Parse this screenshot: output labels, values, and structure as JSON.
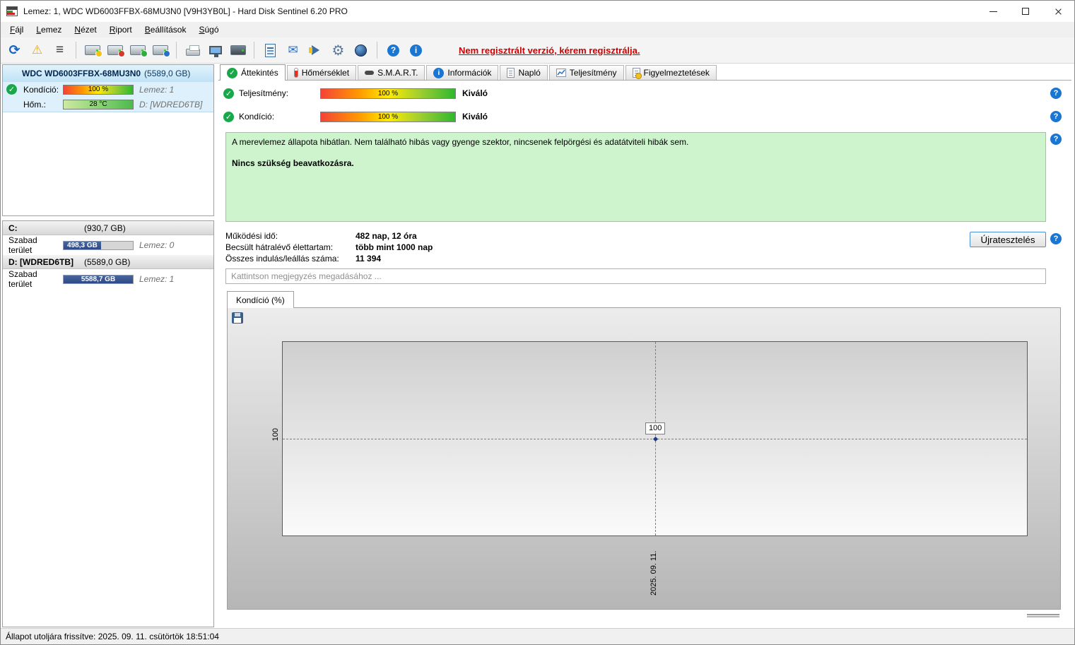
{
  "window": {
    "title": "Lemez: 1, WDC WD6003FFBX-68MU3N0 [V9H3YB0L]  -  Hard Disk Sentinel 6.20 PRO"
  },
  "menu": {
    "items": [
      {
        "label": "Fájl"
      },
      {
        "label": "Lemez"
      },
      {
        "label": "Nézet"
      },
      {
        "label": "Riport"
      },
      {
        "label": "Beállítások"
      },
      {
        "label": "Súgó"
      }
    ]
  },
  "toolbar": {
    "register_notice": "Nem regisztrált verzió, kérem regisztrálja.",
    "glyphs": {
      "refresh": "⟳",
      "warning": "⚠",
      "list": "≡",
      "envelope": "✉",
      "gear": "⚙",
      "help": "?",
      "info": "i"
    }
  },
  "sidebar": {
    "disk": {
      "name": "WDC WD6003FFBX-68MU3N0",
      "size": "(5589,0 GB)",
      "condition_label": "Kondíció:",
      "condition_value": "100 %",
      "disk_index": "Lemez: 1",
      "temp_label": "Hőm.:",
      "temp_value": "28 °C",
      "volume": "D: [WDRED6TB]"
    },
    "partitions": [
      {
        "name": "C:",
        "size": "(930,7 GB)",
        "free_label": "Szabad terület",
        "free_value": "498,3 GB",
        "free_percent": 54,
        "disk_index": "Lemez: 0"
      },
      {
        "name": "D: [WDRED6TB]",
        "size": "(5589,0 GB)",
        "free_label": "Szabad terület",
        "free_value": "5588,7 GB",
        "free_percent": 100,
        "disk_index": "Lemez: 1"
      }
    ]
  },
  "tabs": {
    "items": [
      {
        "label": "Áttekintés"
      },
      {
        "label": "Hőmérséklet"
      },
      {
        "label": "S.M.A.R.T."
      },
      {
        "label": "Információk"
      },
      {
        "label": "Napló"
      },
      {
        "label": "Teljesítmény"
      },
      {
        "label": "Figyelmeztetések"
      }
    ]
  },
  "overview": {
    "performance_label": "Teljesítmény:",
    "performance_value": "100 %",
    "performance_rating": "Kiváló",
    "condition_label": "Kondíció:",
    "condition_value": "100 %",
    "condition_rating": "Kiváló",
    "status_text": "A merevlemez állapota hibátlan. Nem található hibás vagy gyenge szektor, nincsenek felpörgési és adatátviteli hibák sem.",
    "status_bold": "Nincs szükség beavatkozásra.",
    "stats": [
      {
        "label": "Működési idő:",
        "value": "482 nap, 12 óra"
      },
      {
        "label": "Becsült hátralévő élettartam:",
        "value": "több mint 1000 nap"
      },
      {
        "label": "Összes indulás/leállás száma:",
        "value": "11 394"
      }
    ],
    "retest_button": "Újratesztelés",
    "comment_placeholder": "Kattintson megjegyzés megadásához ..."
  },
  "chart_data": {
    "type": "line",
    "title": "Kondíció  (%)",
    "x": [
      "2025. 09. 11."
    ],
    "series": [
      {
        "name": "Kondíció",
        "values": [
          100
        ]
      }
    ],
    "yticks": [
      "100"
    ],
    "point_labels": [
      "100"
    ],
    "ylim": [
      null,
      null
    ],
    "legend": "none",
    "grid": "dashed-crosshair"
  },
  "statusbar": {
    "text": "Állapot utoljára frissítve: 2025. 09. 11. csütörtök 18:51:04"
  }
}
